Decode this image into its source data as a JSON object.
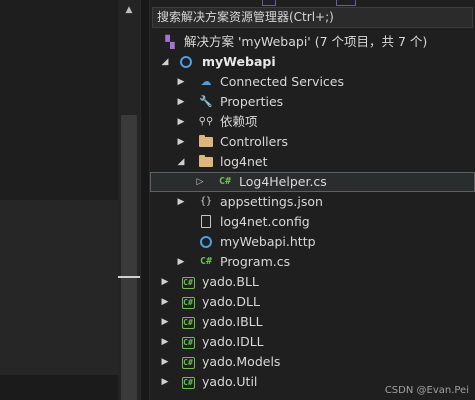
{
  "search": {
    "placeholder": "搜索解决方案资源管理器(Ctrl+;)"
  },
  "solution": {
    "label": "解决方案 'myWebapi' (7 个项目，共 7 个)"
  },
  "project": {
    "name": "myWebapi",
    "items": [
      {
        "label": "Connected Services",
        "icon": "connected-services-icon"
      },
      {
        "label": "Properties",
        "icon": "properties-icon"
      },
      {
        "label": "依赖项",
        "icon": "dependencies-icon"
      },
      {
        "label": "Controllers",
        "icon": "folder-icon"
      },
      {
        "label": "log4net",
        "icon": "folder-icon"
      },
      {
        "label": "Log4Helper.cs",
        "icon": "csharp-file-icon"
      },
      {
        "label": "appsettings.json",
        "icon": "json-file-icon"
      },
      {
        "label": "log4net.config",
        "icon": "config-file-icon"
      },
      {
        "label": "myWebapi.http",
        "icon": "http-file-icon"
      },
      {
        "label": "Program.cs",
        "icon": "csharp-file-icon"
      }
    ]
  },
  "projects": [
    {
      "label": "yado.BLL"
    },
    {
      "label": "yado.DLL"
    },
    {
      "label": "yado.IBLL"
    },
    {
      "label": "yado.IDLL"
    },
    {
      "label": "yado.Models"
    },
    {
      "label": "yado.Util"
    }
  ],
  "watermark": "CSDN @Evan.Pei",
  "colors": {
    "background": "#1f1f1f",
    "csharp": "#6cc04a",
    "folder": "#dcb67a",
    "selection": "#2a2d2e"
  }
}
